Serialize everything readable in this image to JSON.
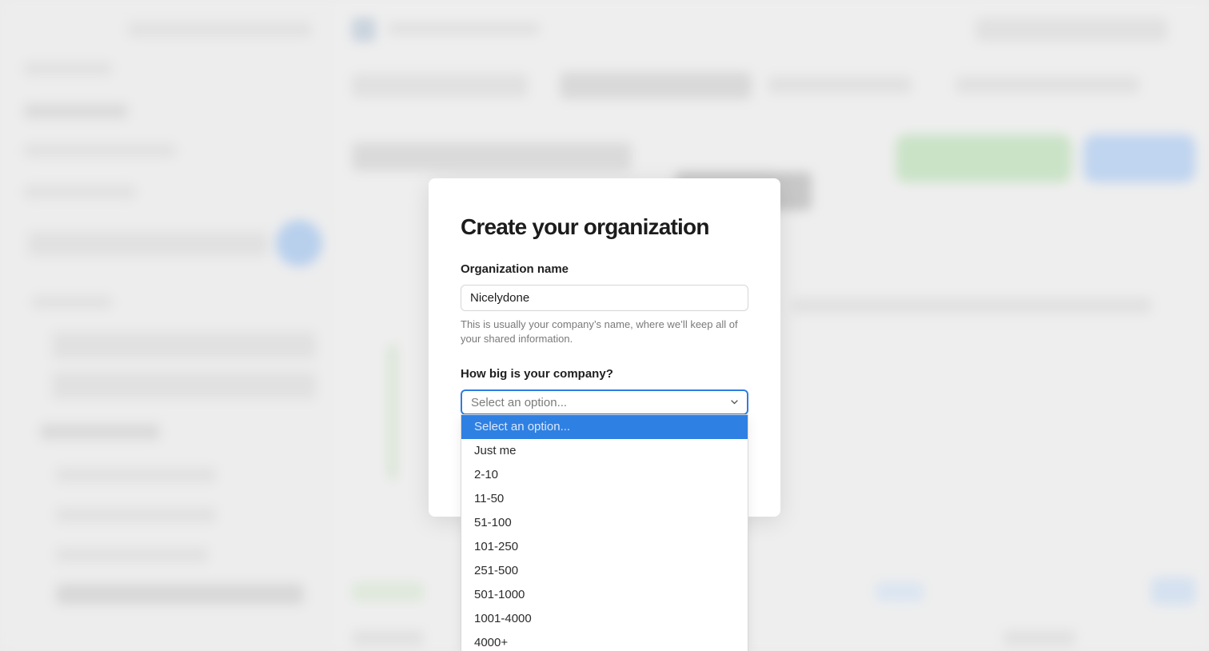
{
  "modal": {
    "title": "Create your organization",
    "org_name_label": "Organization name",
    "org_name_value": "Nicelydone",
    "org_name_helper": "This is usually your company’s name, where we’ll keep all of your shared information.",
    "company_size_label": "How big is your company?",
    "company_size_selected": "Select an option..."
  },
  "dropdown": {
    "options": [
      "Select an option...",
      "Just me",
      "2-10",
      "11-50",
      "51-100",
      "101-250",
      "251-500",
      "501-1000",
      "1001-4000",
      "4000+"
    ],
    "highlighted_index": 0
  },
  "colors": {
    "accent": "#2f80e3",
    "focus_border": "#2f7de1"
  },
  "icons": {
    "select_chevron": "chevron-down-icon"
  }
}
